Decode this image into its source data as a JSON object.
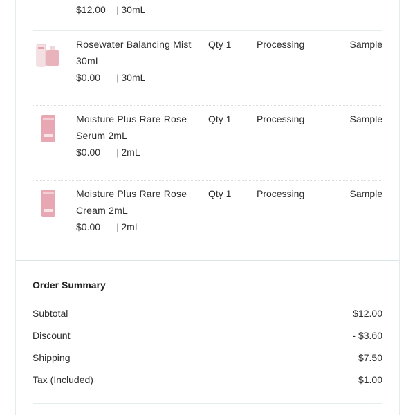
{
  "items": [
    {
      "name": "",
      "price": "$12.00",
      "size": "30mL",
      "qty": "",
      "status": "",
      "kind": "",
      "thumb": "partial-product-image"
    },
    {
      "name": "Rosewater Balancing Mist 30mL",
      "price": "$0.00",
      "size": "30mL",
      "qty": "Qty 1",
      "status": "Processing",
      "kind": "Sample",
      "thumb": "mist-bottle-image"
    },
    {
      "name": "Moisture Plus Rare Rose Serum 2mL",
      "price": "$0.00",
      "size": "2mL",
      "qty": "Qty 1",
      "status": "Processing",
      "kind": "Sample",
      "thumb": "sachet-image"
    },
    {
      "name": "Moisture Plus Rare Rose Cream 2mL",
      "price": "$0.00",
      "size": "2mL",
      "qty": "Qty 1",
      "status": "Processing",
      "kind": "Sample",
      "thumb": "sachet-image"
    }
  ],
  "separator": "|",
  "summary": {
    "title": "Order Summary",
    "rows": [
      {
        "label": "Subtotal",
        "value": "$12.00"
      },
      {
        "label": "Discount",
        "value": "- $3.60"
      },
      {
        "label": "Shipping",
        "value": "$7.50"
      },
      {
        "label": "Tax (Included)",
        "value": "$1.00"
      }
    ]
  },
  "colors": {
    "product_pink": "#d98a9a",
    "sachet_pink": "#e7a7b3",
    "border": "#e3ecec"
  }
}
